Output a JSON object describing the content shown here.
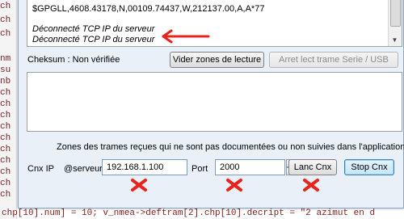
{
  "background_code": {
    "top_lines": [
      "ch",
      "ch",
      "ch"
    ],
    "left_lines": [
      "nm",
      "su",
      "nb",
      "ch",
      "ch",
      "ch",
      "ch",
      "ch",
      "ch",
      "ch",
      "ch",
      "ch",
      "ch"
    ],
    "bottom_line": "chp[10].num] = 10; v_nmea->deftram[2].chp[10].decript = \"2 azimut en d"
  },
  "dialog": {
    "log_lines": [
      "$GPGLL,4608.43178,N,00109.74437,W,212137.00,A,A*77",
      "Déconnecté TCP IP du serveur",
      "Déconnecté TCP IP du serveur"
    ],
    "checksum_label": "Cheksum : Non vérifiée",
    "clear_button": "Vider zones de lecture",
    "stop_serial_button": "Arret lect trame Serie / USB",
    "undocumented_note": "Zones des trames reçues qui ne sont pas documentées ou non suivies dans l'application.",
    "cnx_label": "Cnx IP",
    "server_label": "@serveur",
    "ip_value": "192.168.1.100",
    "port_label": "Port",
    "port_value": "2000",
    "connect_button": "Lanc Cnx",
    "stop_button": "Stop Cnx"
  },
  "colors": {
    "annotation": "#e8231b",
    "dialog_bg": "#e9f0f8"
  }
}
